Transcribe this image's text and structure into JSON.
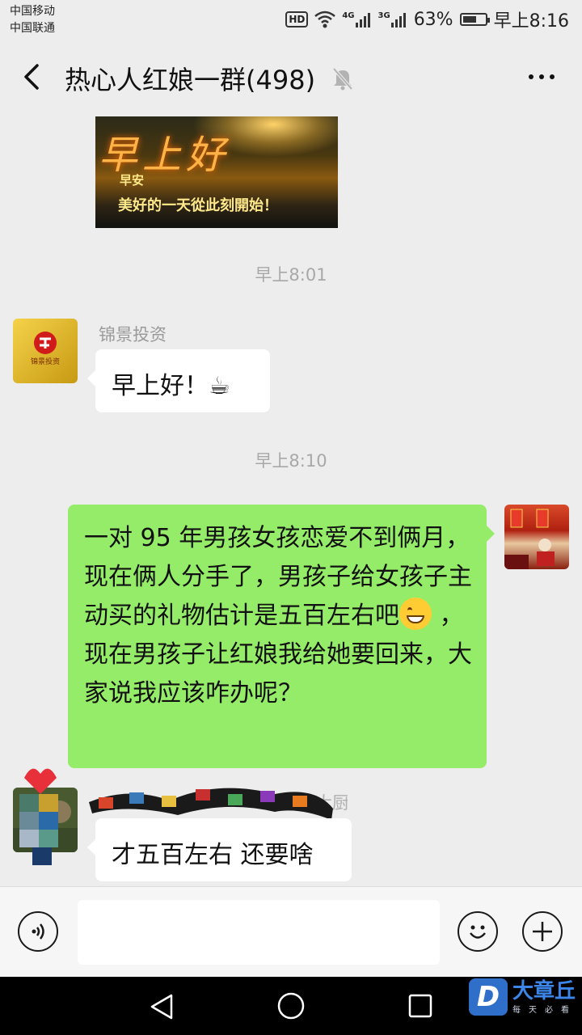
{
  "status_bar": {
    "carrier_1": "中国移动",
    "carrier_2": "中国联通",
    "hd": "HD",
    "net_1": "4G",
    "net_2": "3G",
    "battery": "63%",
    "battery_level": 0.63,
    "time": "早上8:16"
  },
  "header": {
    "title": "热心人红娘一群(498)",
    "back_icon": "chevron-left-icon",
    "mute_icon": "bell-off-icon",
    "more_icon": "more-dots-icon"
  },
  "messages": {
    "image_msg": {
      "script": "早上好",
      "line_1": "早安",
      "line_2": "美好的一天從此刻開始！"
    },
    "time_1": "早上8:01",
    "msg_1": {
      "sender": "锦景投资",
      "text": "早上好！☕",
      "avatar_text": "锦景投资"
    },
    "time_2": "早上8:10",
    "msg_2": {
      "text_a": "一对 95 年男孩女孩恋爱不到俩月，现在俩人分手了，男孩子给女孩子主动买的礼物估计是五百左右吧",
      "text_b": " ，现在男孩子让红娘我给她要回来，大家说我应该咋办呢？"
    },
    "msg_3": {
      "text": "才五百左右 还要啥"
    }
  },
  "input_bar": {
    "voice_icon": "voice-icon",
    "emoji_icon": "emoji-icon",
    "plus_icon": "plus-icon"
  },
  "nav_keys": {
    "back": "triangle-back-icon",
    "home": "circle-home-icon",
    "recents": "square-recents-icon"
  },
  "watermark": {
    "logo": "D",
    "name": "大章丘",
    "tagline": "每天必看"
  }
}
